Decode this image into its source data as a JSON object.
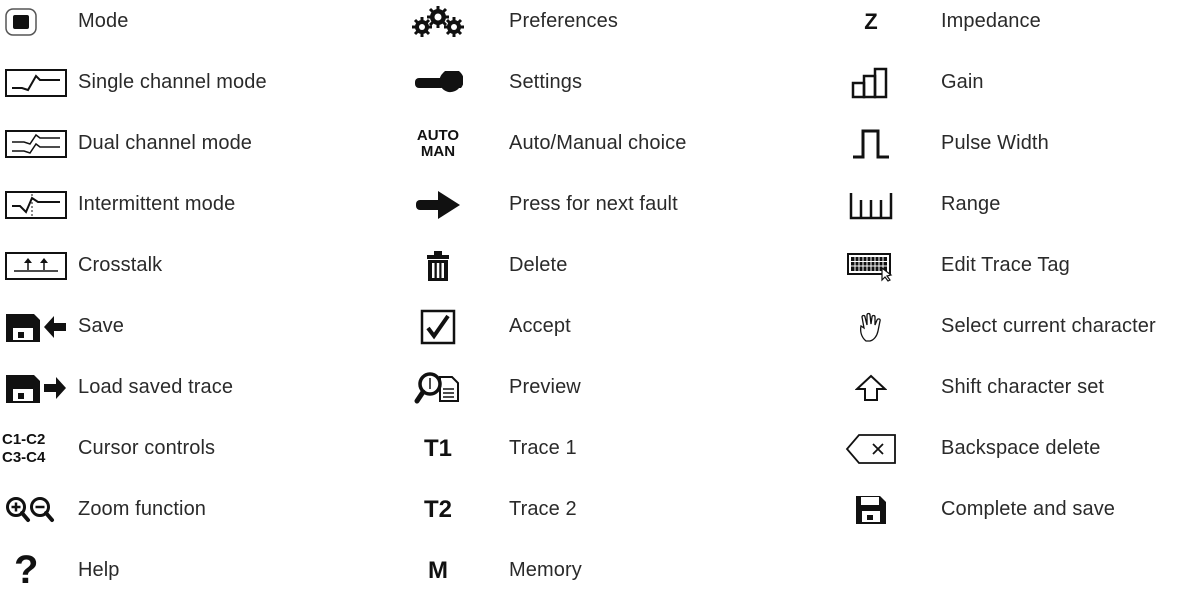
{
  "col1": [
    {
      "icon": "mode-icon",
      "label": "Mode"
    },
    {
      "icon": "single-channel-icon",
      "label": "Single channel mode"
    },
    {
      "icon": "dual-channel-icon",
      "label": "Dual channel mode"
    },
    {
      "icon": "intermittent-icon",
      "label": "Intermittent mode"
    },
    {
      "icon": "crosstalk-icon",
      "label": "Crosstalk"
    },
    {
      "icon": "save-icon",
      "label": "Save"
    },
    {
      "icon": "load-trace-icon",
      "label": "Load saved trace"
    },
    {
      "icon": "cursor-controls-icon",
      "label": "Cursor controls",
      "glyph_top": "C1-C2",
      "glyph_bottom": "C3-C4"
    },
    {
      "icon": "zoom-icon",
      "label": "Zoom function"
    },
    {
      "icon": "help-icon",
      "label": "Help",
      "glyph": "?"
    }
  ],
  "col2": [
    {
      "icon": "gears-icon",
      "label": "Preferences"
    },
    {
      "icon": "wrench-icon",
      "label": "Settings"
    },
    {
      "icon": "auto-manual-icon",
      "label": "Auto/Manual choice",
      "glyph_top": "AUTO",
      "glyph_bottom": "MAN"
    },
    {
      "icon": "arrow-right-icon",
      "label": "Press for next fault"
    },
    {
      "icon": "trash-icon",
      "label": "Delete"
    },
    {
      "icon": "checkmark-icon",
      "label": "Accept"
    },
    {
      "icon": "preview-icon",
      "label": "Preview"
    },
    {
      "icon": "trace1-icon",
      "label": "Trace 1",
      "glyph": "T1"
    },
    {
      "icon": "trace2-icon",
      "label": "Trace 2",
      "glyph": "T2"
    },
    {
      "icon": "memory-icon",
      "label": "Memory",
      "glyph": "M"
    }
  ],
  "col3": [
    {
      "icon": "impedance-icon",
      "label": "Impedance",
      "glyph": "Z"
    },
    {
      "icon": "gain-icon",
      "label": "Gain"
    },
    {
      "icon": "pulse-width-icon",
      "label": "Pulse Width"
    },
    {
      "icon": "range-icon",
      "label": "Range"
    },
    {
      "icon": "keyboard-icon",
      "label": "Edit Trace Tag"
    },
    {
      "icon": "hand-icon",
      "label": "Select current character"
    },
    {
      "icon": "shift-icon",
      "label": "Shift character set"
    },
    {
      "icon": "backspace-icon",
      "label": "Backspace delete"
    },
    {
      "icon": "floppy-icon",
      "label": "Complete and save"
    }
  ]
}
